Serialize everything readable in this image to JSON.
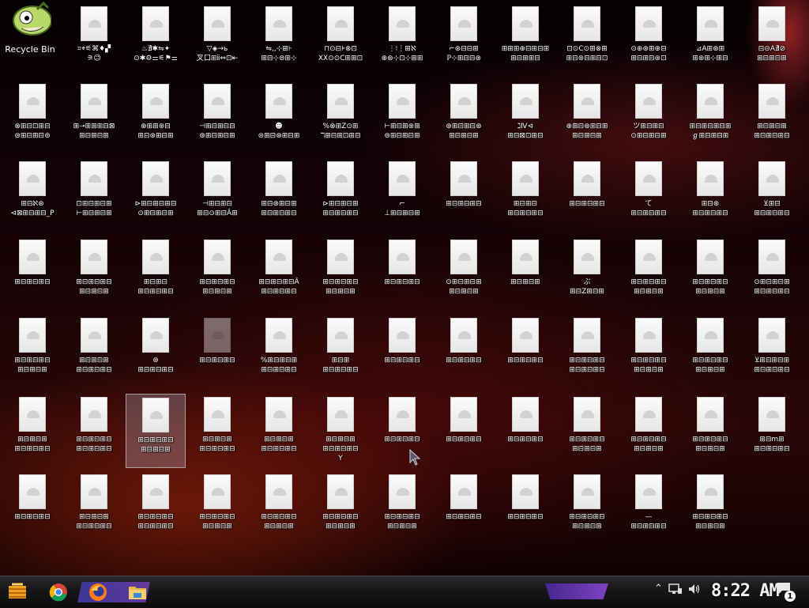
{
  "desktop": {
    "recycle_bin_label": "Recycle Bin",
    "files": [
      "⌗⌖⚟⌘♦▞\n⚞☺",
      "♨∄✱⇋✦\n⊙✱⚙⚌⚟⚑⚌",
      "▽◈→ь\n叉口⊞ⅱ⇔⊡⇤",
      "⇋,,⊹⊞⊦\n⊞⊟⊹⊜⊞⊹",
      "⊓⊙⊟⊧⊗⊡\nXX⊙⊙C⊞⊞⊡",
      "⋮⁝⋮⊞ℵ\n⊕⊛⊹⊡⊹⊞⊞",
      "⌐⊛⊟⊟⊞\nℙ⊹⊞⊟⊟⊛",
      "⊞⊞⊞⊕⊟⊞⊟⊞\n⊞⊟⊞⊞⊟",
      "⊡⊙C⊙⊞⊗⊞\n⊞⊟⊛⊟⊞⊟⊡",
      "⊙⊕⊛⊞⊕⊟\n⊞⊟⊞⊟⊛⊡",
      "⊿A⊞⊛⊞\n⊞⊛⊞⊹⊞⊟",
      "⊟⊝A∄⊘\n⊞⊟⊞⊟⊞",
      "⊗⊞⊟⊡⊞⊟\n⊜⊞⊟⊞⊟⊜",
      "⊞⊸⊞⊞⊞⊟⊠\n⊞⊟⊞⊟⊞",
      "⊕⊞⊞⊛⊟\n⊞⊟⊛⊞⊟⊞",
      "⊣⊞⊟⊞⊟⊟\n⊛⊞⊟⊞⊟⊞",
      "☻\n⊜⊞⊟⊛⊞⊟⊞",
      "%⊗⊞Z⊙⊞\nℸ⊞⊟⊞⊡⊞⊟",
      "⊢⊞⊟⊞⊛⊞\n⊜⊞⊟⊞⊟⊞",
      "⊛⊞⊟⊞⊟⊛\n⊞⊟⊞⊟⊞",
      "ℷⅣ⊲\n⊞⊟⊠⊡⊞⊟",
      "⊕⊞⊟⊛⊞⊟⊞\n⊞⊟⊞⊟⊞",
      "ツ⊞⊟⊞⊟\n⊙⊞⊟⊞⊟⊞",
      "⊞⊟⊞⊟⊞⊟⊞\nℊ⊞⊟⊞⊟⊞",
      "⊞⊟⊞⊟⊞\n⊞⊟⊞⊟⊞⊟",
      "⊞⊟ℵ⊛\n⊲⊠⊞⊟⊞⊟_P",
      "⊡⊞⊟⊞⊟⊞\n⊢⊞⊟⊞⊟⊞",
      "⊳⊞⊟⊞⊟⊞⊟\n⊙⊞⊟⊞⊟⊞",
      "⊣⊞⊟⊞⊟\n⊞⊟⊙⊞⊟Â⊞",
      "⊞⊟⊛⊞⊟⊞\n⊞⊟⊞⊟⊞⊟",
      "⊳⊞⊟⊞⊟⊞\n⊞⊟⊞⊟⊞⊟",
      "⌐\n⊥⊞⊟⊞⊟⊞",
      "⊞⊟⊞⊟⊞⊟\n",
      "⊞⊟⊞⊟\n⊞⊟⊞⊟⊞⊟",
      "⊞⊟⊞⊟⊞⊟\n",
      "て\n⊞⊟⊞⊟⊞⊟",
      "⊞⊟⊛\n⊞⊟⊞⊟⊞⊟",
      "⊻⊞⊟\n⊞⊟⊞⊟⊞⊟",
      "⊞⊟⊞⊟⊞⊟\n",
      "⊞⊟⊞⊟⊞⊟\n⊞⊟⊞⊟⊞",
      "⊞⊟⊞⊟\n⊞⊟⊞⊟⊞⊟",
      "⊞⊟⊞⊟⊞⊟\n⊞⊟⊞⊟⊞",
      "⊞⊟⊞⊟⊞⊟Â\n⊞⊟⊞⊟⊞⊟",
      "⊞⊟⊞⊟⊞⊟\n⊞⊟⊞⊟⊞",
      "⊞⊟⊞⊟⊞⊟\n",
      "⊙⊞⊟⊞⊟⊞\n⊞⊟⊞⊟⊞",
      "⊞⊟⊞⊟⊞\n",
      "ぶ\n⊞⊟Z⊞⊟⊞",
      "⊞⊟⊞⊟⊞⊟\n⊞⊟⊞⊟⊞",
      "⊞⊟⊞⊟⊞⊟\n⊞⊟⊞⊟⊞",
      "⊙⊞⊟⊞⊟⊞\n⊞⊟⊞⊟⊞⊟",
      "⊞⊟⊞⊟⊞⊟\n⊞⊟⊞⊟⊞",
      "⊞⊟⊞⊟⊞\n⊞⊟⊞⊟⊞⊟",
      "⊛\n⊞⊟⊞⊟⊞⊟",
      "⊞⊟⊞⊟⊞⊟\n",
      "%⊞⊟⊞⊟⊞\n⊞⊟⊞⊟⊞⊟",
      "⊞⊟⊞\n⊞⊟⊞⊟⊞⊟",
      "⊞⊟⊞⊟⊞⊟\n",
      "⊞⊟⊞⊟⊞⊟\n",
      "⊞⊟⊞⊟⊞⊟\n",
      "⊞⊟⊞⊟⊞⊟\n⊞⊟⊞⊟⊞⊟",
      "⊞⊟⊞⊟⊞⊟\n⊞⊟⊞⊟⊞",
      "⊞⊟⊞⊟⊞⊟\n⊞⊟⊞⊟⊞",
      "⊻⊞⊟⊞⊟⊞\n⊞⊟⊞⊟⊞⊟",
      "⊞⊟⊞⊟⊞\n⊞⊟⊞⊟⊞⊟",
      "⊞⊟⊞⊟⊞⊟\n⊞⊟⊞⊟⊞⊟",
      "⊞⊟⊞⊟⊞⊟\n⊞⊟⊞⊟⊞",
      "⊞⊟⊞⊟⊞\n⊞⊟⊞⊟⊞⊟",
      "⊞⊟⊞⊟⊞\n⊞⊟⊞⊟⊞⊟",
      "⊞⊟⊞⊟⊞\n⊞⊟⊞⊟⊞⊟\nY",
      "⊞⊟⊞⊟⊞⊟\n",
      "⊞⊟⊞⊟⊞⊟\n",
      "⊞⊟⊞⊟⊞⊟\n",
      "⊞⊟⊞⊟⊞⊟\n⊞⊟⊞⊟⊞",
      "⊞⊟⊞⊟⊞⊟\n⊞⊟⊞⊟⊞",
      "⊞⊟⊞⊟⊞⊟\n⊞⊟⊞⊟⊞",
      "⊞⊟m⊞\n⊞⊟⊞⊟⊞⊟",
      "⊞⊟⊞⊟⊞⊟\n",
      "⊞⊟⊞⊟⊞\n⊞⊟⊞⊟⊞⊟",
      "⊞⊟⊞⊟⊞⊟\n⊞⊟⊞⊟⊞⊟",
      "⊞⊟⊞⊟⊞⊟\n⊞⊟⊞⊟⊞",
      "⊞⊟⊞⊟⊞⊟\n⊞⊟⊞⊟⊞",
      "⊞⊟⊞⊟⊞⊟\n⊞⊟⊞⊟⊞",
      "⊞⊟⊞⊟⊞⊟\n⊞⊟⊞⊟⊞",
      "⊞⊟⊞⊟⊞⊟\n",
      "⊞⊟⊞⊟⊞⊟\n",
      "⊞⊟⊞⊟⊞⊟\n⊞⊟⊞⊟⊞",
      "—\n⊞⊟⊞⊟⊞⊟",
      "⊞⊟⊞⊟⊞⊟\n⊞⊟⊞⊟⊞"
    ],
    "selected_index": 66,
    "dimmed_index": 54
  },
  "taskbar": {
    "start_icon": "start-icon",
    "pinned": [
      "chrome-icon",
      "firefox-icon",
      "file-explorer-icon"
    ],
    "clock": "8:22 AM",
    "notification_count": "1",
    "tray": [
      "show-hidden-icons-chevron-icon",
      "network-icon",
      "volume-icon"
    ]
  },
  "colors": {
    "taskbar_bg": "#161618",
    "accent_purple": "#7a4bc8",
    "selection": "#c8c8dc"
  }
}
